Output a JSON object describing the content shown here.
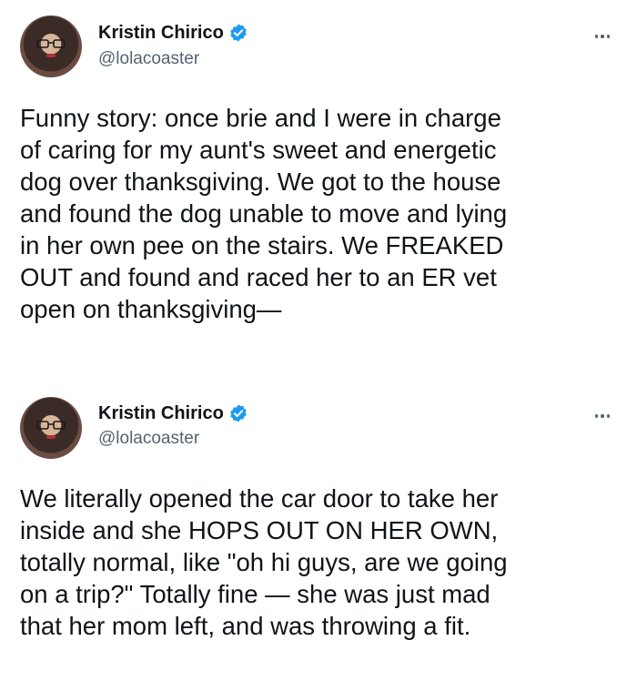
{
  "tweets": [
    {
      "author": {
        "name": "Kristin Chirico",
        "handle": "@lolacoaster",
        "verified": true
      },
      "text": "Funny story: once brie and I were in charge\nof caring for my aunt's sweet and energetic\ndog over thanksgiving. We got to the house\nand found the dog unable to move and lying\nin her own pee on the stairs. We FREAKED\nOUT and found and raced her to an ER vet\nopen on thanksgiving—"
    },
    {
      "author": {
        "name": "Kristin Chirico",
        "handle": "@lolacoaster",
        "verified": true
      },
      "text": "We literally opened the car door to take her\ninside and she HOPS OUT ON HER OWN,\ntotally normal, like \"oh hi guys, are we going\non a trip?\" Totally fine — she was just mad\nthat her mom left, and was throwing a fit."
    }
  ],
  "colors": {
    "verified_badge": "#1d9bf0",
    "text": "#0f1419",
    "secondary_text": "#536471"
  },
  "icons": {
    "verified": "verified-badge-icon",
    "more": "more-options-icon"
  }
}
